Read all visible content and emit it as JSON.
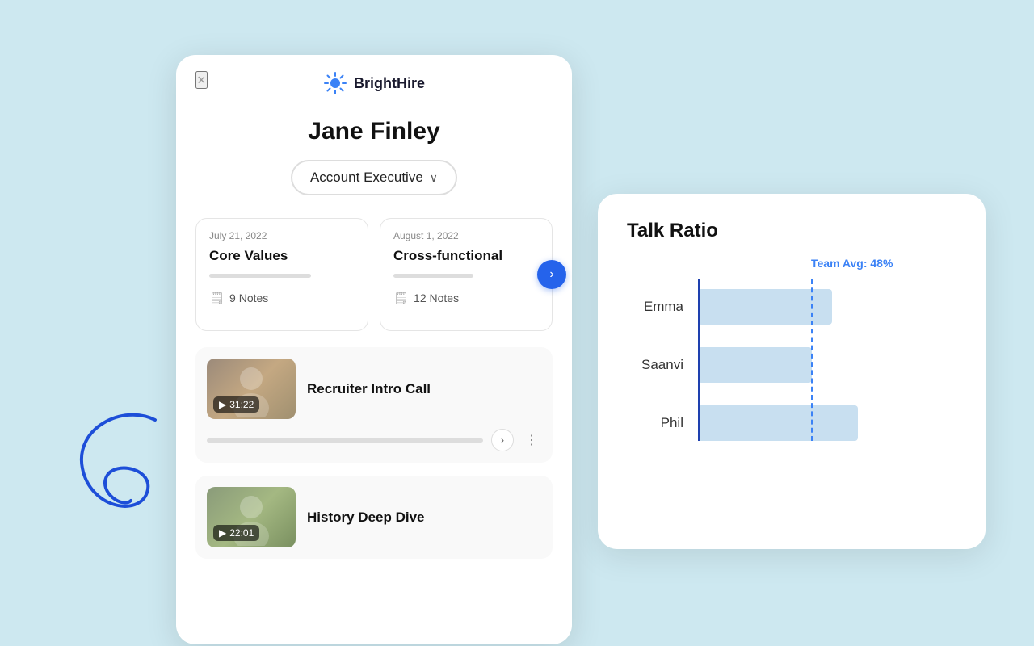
{
  "app": {
    "name": "BrightHire",
    "background_color": "#cde8f0"
  },
  "candidate": {
    "name": "Jane Finley",
    "role": "Account Executive",
    "role_placeholder": "Account Executive"
  },
  "interviews": [
    {
      "date": "July 21, 2022",
      "title": "Core Values",
      "notes_count": "9 Notes"
    },
    {
      "date": "August 1, 2022",
      "title": "Cross-functional",
      "notes_count": "12 Notes"
    }
  ],
  "videos": [
    {
      "duration": "31:22",
      "title": "Recruiter Intro Call"
    },
    {
      "duration": "22:01",
      "title": "History Deep Dive"
    }
  ],
  "chart": {
    "title": "Talk Ratio",
    "team_avg_label": "Team Avg: 48%",
    "people": [
      {
        "name": "Emma",
        "bar_width": "52%"
      },
      {
        "name": "Saanvi",
        "bar_width": "44%"
      },
      {
        "name": "Phil",
        "bar_width": "62%"
      }
    ]
  },
  "close_label": "×",
  "arrow_label": "›",
  "play_symbol": "▶",
  "chevron_down": "∨",
  "nav_arrow": "›",
  "more_dots": "⋮"
}
